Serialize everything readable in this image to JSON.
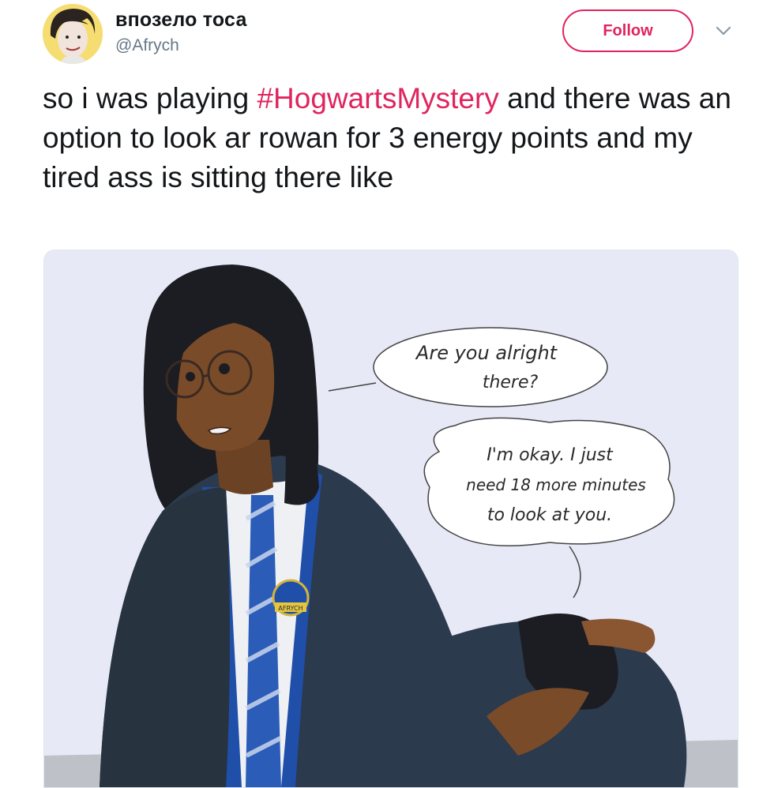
{
  "user": {
    "display_name": "впозело тоса",
    "handle": "@Afrych",
    "avatar_alt": "avatar"
  },
  "follow_button": {
    "label": "Follow"
  },
  "menu": {
    "icon": "chevron-down-icon"
  },
  "tweet": {
    "text_before": "so i was playing ",
    "hashtag": "#HogwartsMystery",
    "text_after": " and there was an option to look ar rowan for 3 energy points and my tired ass is sitting there like"
  },
  "media": {
    "bubble_1": {
      "line_1": "Are you alright",
      "line_2": "there?"
    },
    "bubble_2": {
      "line_1": "I'm okay. I just",
      "line_2": "need 18 more minutes",
      "line_3": "to look at you."
    },
    "badge_text": "AFRYCH"
  },
  "colors": {
    "accent": "#e0245e",
    "text": "#14171a",
    "secondary": "#657786",
    "robe": "#2b3a4c",
    "ravenclaw_blue": "#1f4fa8"
  }
}
